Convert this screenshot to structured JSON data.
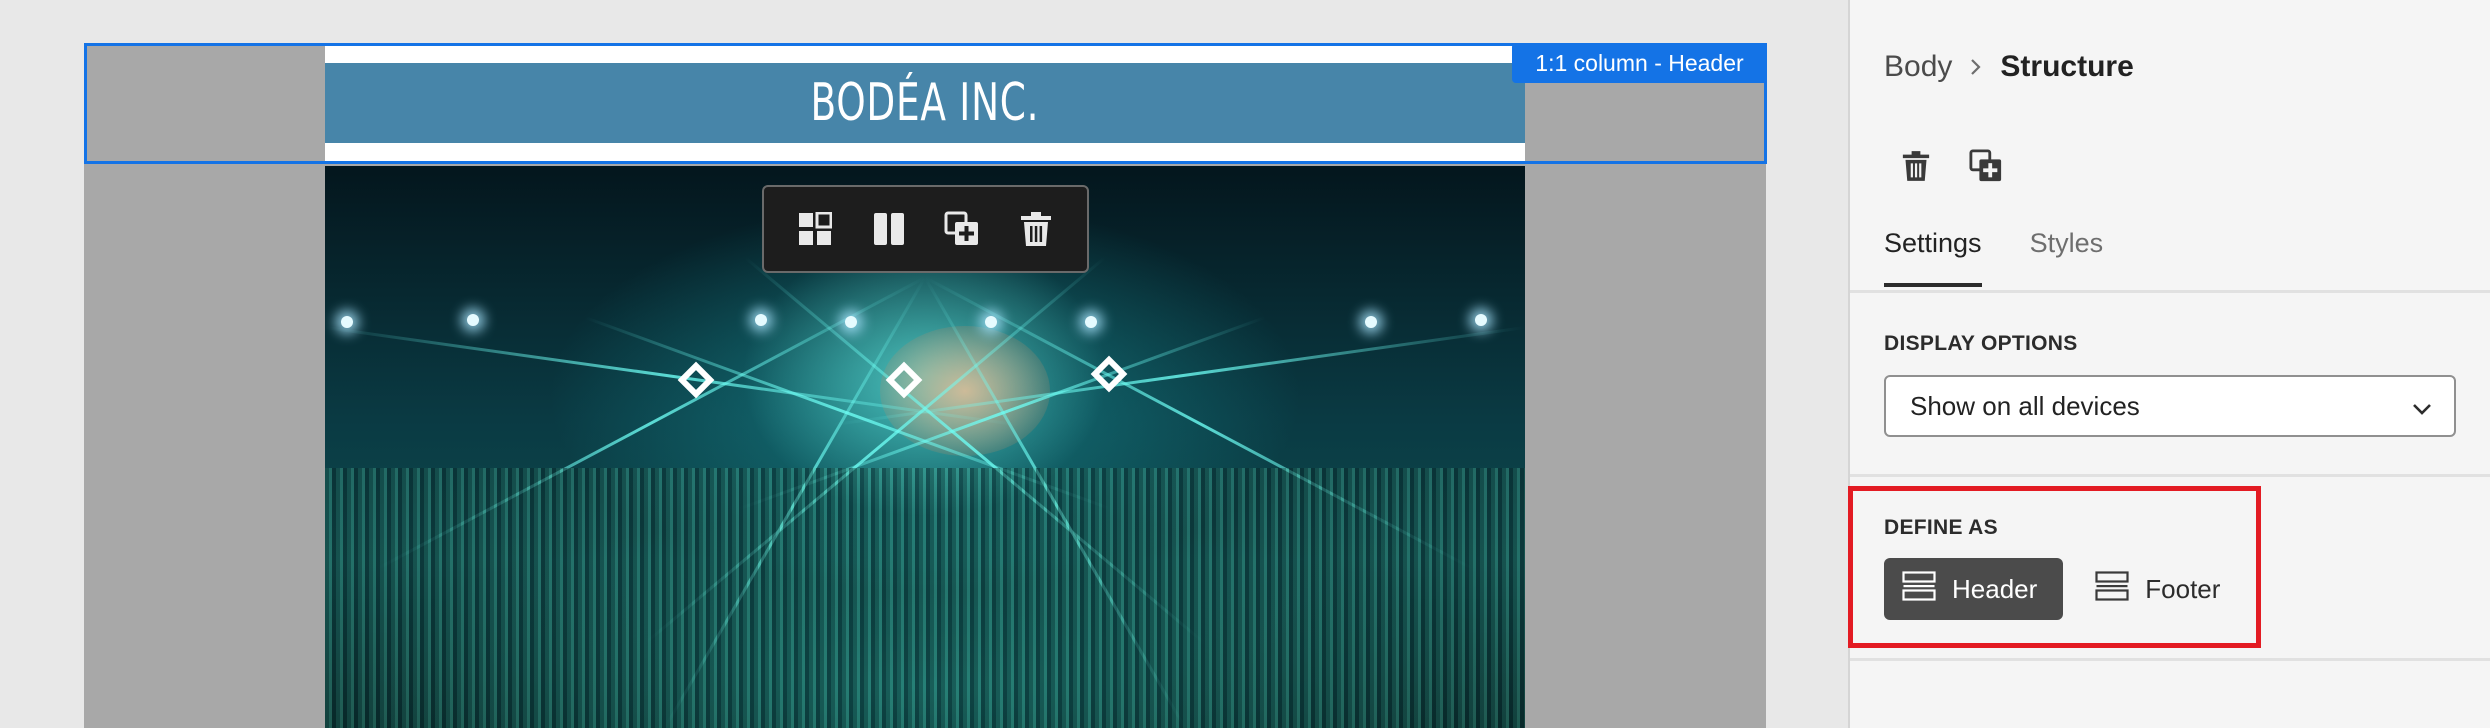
{
  "canvas": {
    "brand": "BODÉA INC.",
    "selection_tag": "1:1 column - Header",
    "toolbar": {
      "icons": [
        "grid-icon",
        "columns-icon",
        "duplicate-icon",
        "trash-icon"
      ]
    },
    "hero_image": "concert-crowd-stage-lights"
  },
  "panel": {
    "breadcrumb": {
      "parent": "Body",
      "current": "Structure"
    },
    "actions": [
      "trash-icon",
      "duplicate-icon"
    ],
    "tabs": [
      {
        "label": "Settings",
        "active": true
      },
      {
        "label": "Styles",
        "active": false
      }
    ],
    "display_options": {
      "label": "DISPLAY OPTIONS",
      "selected": "Show on all devices"
    },
    "define_as": {
      "label": "DEFINE AS",
      "options": [
        {
          "label": "Header",
          "selected": true
        },
        {
          "label": "Footer",
          "selected": false
        }
      ]
    }
  },
  "colors": {
    "selection": "#1473e6",
    "header_band": "#4785a9",
    "highlight": "#e31b23",
    "selected_button": "#4b4b4b"
  }
}
